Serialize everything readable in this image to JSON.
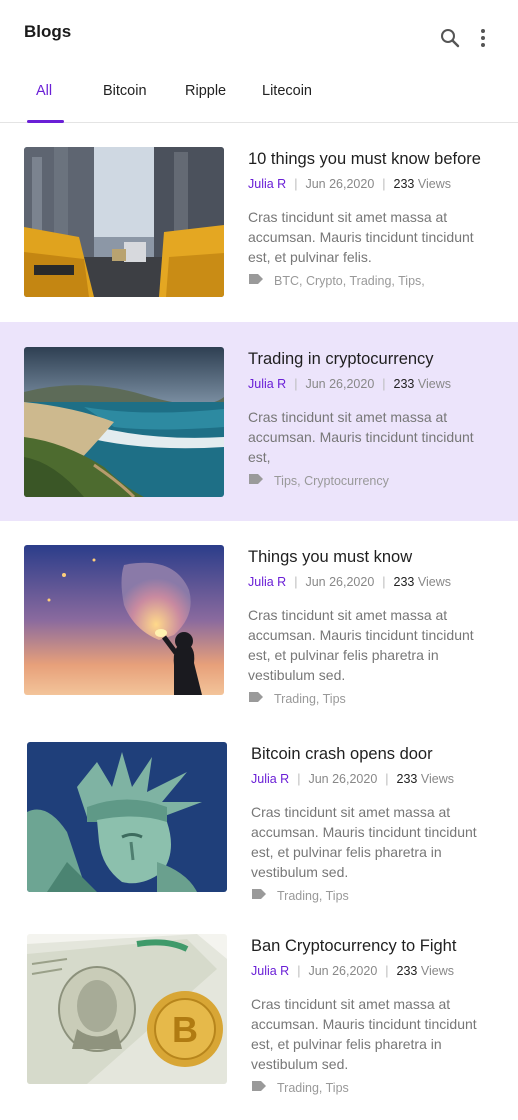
{
  "header": {
    "title": "Blogs",
    "search_icon": "search-icon",
    "more_icon": "more-vertical-icon"
  },
  "tabs": [
    {
      "label": "All",
      "active": true
    },
    {
      "label": "Bitcoin"
    },
    {
      "label": "Ripple"
    },
    {
      "label": "Litecoin"
    }
  ],
  "colors": {
    "accent": "#6a1fd6",
    "highlight_row": "#ece4fb"
  },
  "posts": [
    {
      "title": "10 things you must know before",
      "author": "Julia R",
      "date": "Jun 26,2020",
      "views": "233",
      "views_label": "Views",
      "excerpt": "Cras tincidunt sit amet massa at accumsan. Mauris tincidunt tincidunt est, et pulvinar felis.",
      "tags": "BTC, Crypto, Trading, Tips,",
      "image": "city-taxis"
    },
    {
      "title": "Trading in cryptocurrency",
      "author": "Julia R",
      "date": "Jun 26,2020",
      "views": "233",
      "views_label": "Views",
      "excerpt": "Cras tincidunt sit amet massa at accumsan. Mauris tincidunt tincidunt est,",
      "tags": "Tips, Cryptocurrency",
      "image": "coastal-beach"
    },
    {
      "title": "Things you must know",
      "author": "Julia R",
      "date": "Jun 26,2020",
      "views": "233",
      "views_label": "Views",
      "excerpt": "Cras tincidunt sit amet massa at accumsan. Mauris tincidunt tincidunt est, et pulvinar felis pharetra in vestibulum sed.",
      "tags": "Trading, Tips",
      "image": "sky-lantern"
    },
    {
      "title": "Bitcoin crash opens door",
      "author": "Julia R",
      "date": "Jun 26,2020",
      "views": "233",
      "views_label": "Views",
      "excerpt": "Cras tincidunt sit amet massa at accumsan. Mauris tincidunt tincidunt est, et pulvinar felis pharetra in vestibulum sed.",
      "tags": "Trading, Tips",
      "image": "statue-of-liberty"
    },
    {
      "title": "Ban Cryptocurrency to Fight",
      "author": "Julia R",
      "date": "Jun 26,2020",
      "views": "233",
      "views_label": "Views",
      "excerpt": "Cras tincidunt sit amet massa at accumsan. Mauris tincidunt tincidunt est, et pulvinar felis pharetra in vestibulum sed.",
      "tags": "Trading, Tips",
      "image": "dollar-bitcoin"
    }
  ]
}
